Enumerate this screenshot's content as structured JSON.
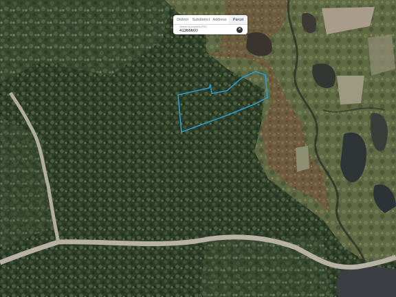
{
  "search": {
    "tabs": [
      "District",
      "Subdistrict",
      "Address",
      "Parcel"
    ],
    "active_tab": "Parcel",
    "label": "Search by property (PID)",
    "value": "41366600",
    "clear_icon": "close-circle-icon"
  },
  "map": {
    "basemap": "satellite-imagery",
    "parcel_outline_color": "#2a9fd6"
  }
}
